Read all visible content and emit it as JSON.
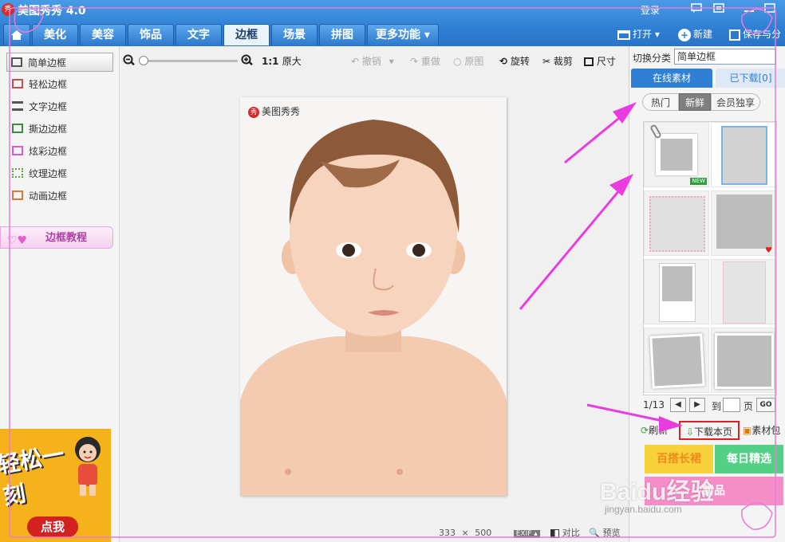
{
  "app": {
    "title": "美图秀秀 4.0",
    "logo_text": "秀",
    "login": "登录"
  },
  "window_controls": [
    "chat-icon",
    "skin-icon",
    "minimize-icon",
    "maximize-icon"
  ],
  "tabs": [
    {
      "label": "",
      "icon": "home-icon"
    },
    {
      "label": "美化"
    },
    {
      "label": "美容"
    },
    {
      "label": "饰品"
    },
    {
      "label": "文字"
    },
    {
      "label": "边框",
      "active": true
    },
    {
      "label": "场景"
    },
    {
      "label": "拼图"
    },
    {
      "label": "更多功能 ▾"
    }
  ],
  "header_actions": {
    "open": "打开 ▾",
    "new": "新建",
    "save": "保存与分"
  },
  "left_panel": {
    "items": [
      {
        "label": "简单边框",
        "active": true
      },
      {
        "label": "轻松边框"
      },
      {
        "label": "文字边框"
      },
      {
        "label": "撕边边框"
      },
      {
        "label": "炫彩边框"
      },
      {
        "label": "纹理边框"
      },
      {
        "label": "动画边框"
      }
    ],
    "tutorial": "边框教程",
    "ad": {
      "text": "轻松一刻",
      "button": "点我"
    }
  },
  "toolbar": {
    "ratio": "1:1",
    "original": "原大",
    "undo": "撤销",
    "redo": "重做",
    "origin_img": "原图",
    "rotate": "旋转",
    "crop": "裁剪",
    "size": "尺寸",
    "zoom_level": 0.0
  },
  "canvas": {
    "watermark": "美图秀秀",
    "watermark_logo": "秀",
    "width": "333",
    "times": "×",
    "height": "500",
    "exif": "EXIF ▴",
    "compare": "对比",
    "preview": "预览"
  },
  "right_panel": {
    "switch_label": "切换分类",
    "category": "简单边框",
    "tabs": [
      "在线素材",
      "已下载[0]"
    ],
    "filters": [
      "热门",
      "新鲜",
      "会员独享"
    ],
    "active_filter": "新鲜",
    "new_badge": "NEW",
    "pager": {
      "current": "1/13",
      "goto_label": "到",
      "page_unit": "页",
      "go": "GO"
    },
    "actions": {
      "refresh": "刷新",
      "download_page": "下载本页",
      "material_pack": "素材包"
    },
    "promos": [
      "百搭长裙",
      "每日精选",
      "新品"
    ]
  },
  "watermark_overlay": {
    "brand": "Baidu经验",
    "url": "jingyan.baidu.com"
  },
  "colors": {
    "title_bar": "#2f7fd4",
    "highlight_box": "#e02020",
    "annotation_arrow": "#e83ce0"
  }
}
